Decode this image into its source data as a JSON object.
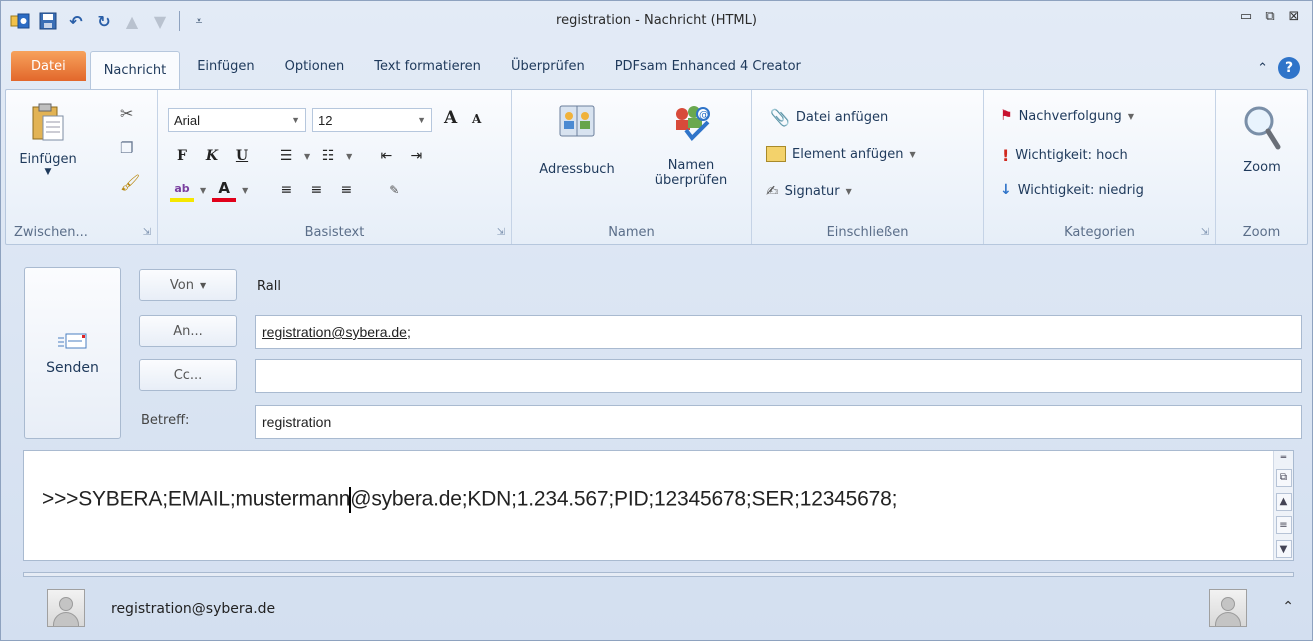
{
  "window": {
    "title": "registration - Nachricht (HTML)",
    "minimize_icon": "minimize-icon",
    "restore_icon": "restore-icon",
    "close_icon": "close-icon"
  },
  "tabs": [
    {
      "label": "Datei"
    },
    {
      "label": "Nachricht"
    },
    {
      "label": "Einfügen"
    },
    {
      "label": "Optionen"
    },
    {
      "label": "Text formatieren"
    },
    {
      "label": "Überprüfen"
    },
    {
      "label": "PDFsam Enhanced 4 Creator"
    }
  ],
  "ribbon": {
    "clipboard": {
      "paste": "Einfügen",
      "label": "Zwischen..."
    },
    "basic_text": {
      "font": "Arial",
      "size": "12",
      "bold": "F",
      "italic": "K",
      "underline": "U",
      "label": "Basistext"
    },
    "names": {
      "address_book": "Adressbuch",
      "check_names_1": "Namen",
      "check_names_2": "überprüfen",
      "label": "Namen"
    },
    "include": {
      "attach_file": "Datei anfügen",
      "attach_item": "Element anfügen",
      "signature": "Signatur",
      "label": "Einschließen"
    },
    "tags": {
      "follow_up": "Nachverfolgung",
      "high": "Wichtigkeit: hoch",
      "low": "Wichtigkeit: niedrig",
      "label": "Kategorien"
    },
    "zoom": {
      "button": "Zoom",
      "label": "Zoom"
    }
  },
  "header": {
    "send": "Senden",
    "from_button": "Von",
    "from_value": "Rall",
    "to_button": "An...",
    "to_value": "registration@sybera.de",
    "to_sep": ";",
    "cc_button": "Cc...",
    "cc_value": "",
    "subject_label": "Betreff:",
    "subject_value": "registration"
  },
  "body": {
    "text_before": ">>>SYBERA;EMAIL;mustermann",
    "text_after": "@sybera.de;KDN;1.234.567;PID;12345678;SER;12345678;"
  },
  "people": {
    "email": "registration@sybera.de"
  },
  "colors": {
    "file_tab": "#e2672b",
    "accent": "#2f74c9"
  }
}
